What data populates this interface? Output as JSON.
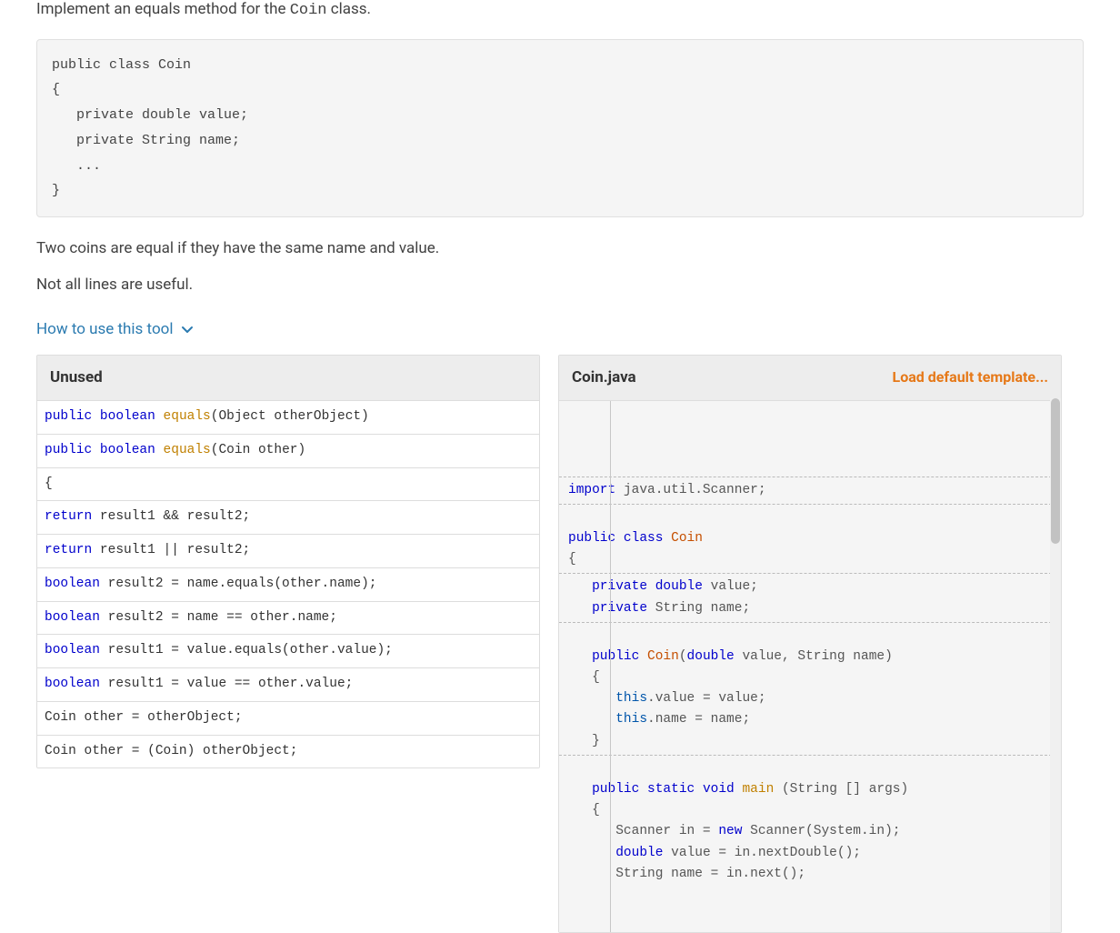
{
  "intro_prefix": "Implement an equals method for the ",
  "intro_code": "Coin",
  "intro_suffix": " class.",
  "code_snippet": "public class Coin\n{\n   private double value;\n   private String name;\n   ...\n}",
  "para1": "Two coins are equal if they have the same name and value.",
  "para2": "Not all lines are useful.",
  "tool_link": "How to use this tool",
  "left_header": "Unused",
  "right_header": "Coin.java",
  "load_link": "Load default template...",
  "tiles": [
    {
      "html": "<span class=\"kw\">public</span> <span class=\"kw\">boolean</span> <span class=\"fn\">equals</span>(Object otherObject)"
    },
    {
      "html": "<span class=\"kw\">public</span> <span class=\"kw\">boolean</span> <span class=\"fn\">equals</span>(Coin other)"
    },
    {
      "html": "{"
    },
    {
      "html": "<span class=\"kw\">return</span> result1 &amp;&amp; result2;"
    },
    {
      "html": "<span class=\"kw\">return</span> result1 || result2;"
    },
    {
      "html": "<span class=\"kw\">boolean</span> result2 = name.equals(other.name);"
    },
    {
      "html": "<span class=\"kw\">boolean</span> result2 = name == other.name;"
    },
    {
      "html": "<span class=\"kw\">boolean</span> result1 = value.equals(other.value);"
    },
    {
      "html": "<span class=\"kw\">boolean</span> result1 = value == other.value;"
    },
    {
      "html": "Coin other = otherObject;"
    },
    {
      "html": "Coin other = (Coin) otherObject;"
    }
  ],
  "code_lines": [
    {
      "html": "<span class=\"kw\">import</span> java.util.Scanner;",
      "sep": true
    },
    {
      "html": "",
      "sep": false
    },
    {
      "html": "<span class=\"kw\">public</span> <span class=\"kw\">class</span> <span class=\"type2\">Coin</span>",
      "sep": false
    },
    {
      "html": "{",
      "sep": true
    },
    {
      "html": "   <span class=\"kw\">private</span> <span class=\"kw\">double</span> value;",
      "sep": false
    },
    {
      "html": "   <span class=\"kw\">private</span> String name;",
      "sep": true
    },
    {
      "html": "",
      "sep": false
    },
    {
      "html": "   <span class=\"kw\">public</span> <span class=\"type2\">Coin</span>(<span class=\"kw\">double</span> value, String name)",
      "sep": false
    },
    {
      "html": "   {",
      "sep": false
    },
    {
      "html": "      <span class=\"kw2\">this</span>.value = value;",
      "sep": false
    },
    {
      "html": "      <span class=\"kw2\">this</span>.name = name;",
      "sep": false
    },
    {
      "html": "   }",
      "sep": true
    },
    {
      "html": "",
      "sep": false
    },
    {
      "html": "   <span class=\"kw\">public</span> <span class=\"kw\">static</span> <span class=\"kw\">void</span> <span class=\"fn\">main</span> (String [] args)",
      "sep": false
    },
    {
      "html": "   {",
      "sep": false
    },
    {
      "html": "      Scanner in = <span class=\"kw\">new</span> Scanner(System.in);",
      "sep": false
    },
    {
      "html": "      <span class=\"kw\">double</span> value = in.nextDouble();",
      "sep": false
    },
    {
      "html": "      String name = in.next();",
      "sep": false
    }
  ]
}
